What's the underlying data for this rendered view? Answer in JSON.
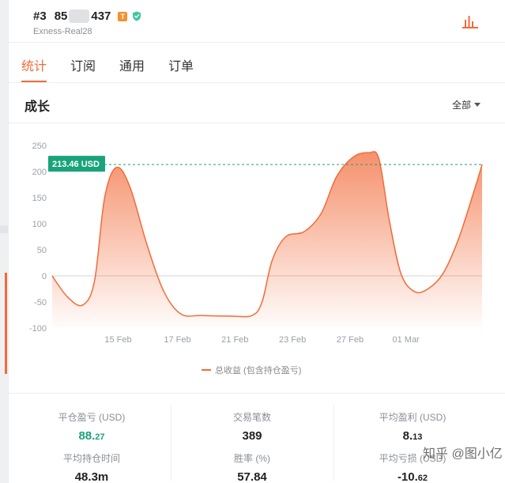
{
  "account": {
    "rank": "#3",
    "id_prefix": "85",
    "id_suffix": "437",
    "badge_t": "T",
    "server": "Exness-Real28",
    "icons": {
      "badge": "t-badge-icon",
      "verified": "shield-check-icon",
      "chart": "bar-chart-icon"
    },
    "colors": {
      "badge": "#f5902c",
      "verified": "#3cc7a3"
    }
  },
  "tabs": [
    {
      "label": "统计",
      "active": true
    },
    {
      "label": "订阅",
      "active": false
    },
    {
      "label": "通用",
      "active": false
    },
    {
      "label": "订单",
      "active": false
    }
  ],
  "section": {
    "title": "成长",
    "range_label": "全部",
    "range_icon": "caret-down-icon"
  },
  "chart_data": {
    "type": "area",
    "title": "",
    "xlabel": "",
    "ylabel": "",
    "ylim": [
      -100,
      250
    ],
    "yticks": [
      250,
      200,
      150,
      100,
      50,
      0,
      -50,
      -100
    ],
    "x_ticks": [
      "15 Feb",
      "17 Feb",
      "21 Feb",
      "23 Feb",
      "27 Feb",
      "01 Mar"
    ],
    "grid": false,
    "legend_placement": "bottom-center",
    "current_value_label": "213.46 USD",
    "current_value": 213.46,
    "series": [
      {
        "name": "总收益 (包含持仓盈亏)",
        "color": "#f26b3a",
        "points": [
          {
            "x": 0.0,
            "y": 0
          },
          {
            "x": 0.9,
            "y": -40
          },
          {
            "x": 1.8,
            "y": -56
          },
          {
            "x": 2.5,
            "y": -10
          },
          {
            "x": 3.1,
            "y": 150
          },
          {
            "x": 3.8,
            "y": 208
          },
          {
            "x": 4.6,
            "y": 170
          },
          {
            "x": 5.6,
            "y": 60
          },
          {
            "x": 6.6,
            "y": -30
          },
          {
            "x": 7.6,
            "y": -73
          },
          {
            "x": 8.8,
            "y": -76
          },
          {
            "x": 10.5,
            "y": -77
          },
          {
            "x": 11.8,
            "y": -76
          },
          {
            "x": 12.4,
            "y": -50
          },
          {
            "x": 13.0,
            "y": 30
          },
          {
            "x": 13.8,
            "y": 75
          },
          {
            "x": 14.9,
            "y": 85
          },
          {
            "x": 15.9,
            "y": 120
          },
          {
            "x": 16.8,
            "y": 190
          },
          {
            "x": 17.8,
            "y": 228
          },
          {
            "x": 18.7,
            "y": 236
          },
          {
            "x": 19.3,
            "y": 225
          },
          {
            "x": 19.9,
            "y": 110
          },
          {
            "x": 20.6,
            "y": 5
          },
          {
            "x": 21.4,
            "y": -30
          },
          {
            "x": 22.2,
            "y": -25
          },
          {
            "x": 23.1,
            "y": 5
          },
          {
            "x": 24.0,
            "y": 70
          },
          {
            "x": 24.9,
            "y": 160
          },
          {
            "x": 25.4,
            "y": 213.46
          }
        ],
        "x_tick_positions": [
          3.9,
          7.4,
          10.8,
          14.2,
          17.6,
          20.9
        ]
      }
    ]
  },
  "stats": [
    {
      "label": "平仓盈亏 (USD)",
      "value_int": "88.",
      "value_dec": "27",
      "highlight": true
    },
    {
      "label": "交易笔数",
      "value_int": "389",
      "value_dec": "",
      "highlight": false
    },
    {
      "label": "平均盈利 (USD)",
      "value_int": "8.",
      "value_dec": "13",
      "highlight": false
    },
    {
      "label": "平均持仓时间",
      "value_int": "48.3m",
      "value_dec": "",
      "highlight": false
    },
    {
      "label": "胜率 (%)",
      "value_int": "57.84",
      "value_dec": "",
      "highlight": false
    },
    {
      "label": "平均亏损 (USD)",
      "value_int": "-10.",
      "value_dec": "62",
      "highlight": false
    }
  ],
  "watermark": "知乎 @图小亿"
}
